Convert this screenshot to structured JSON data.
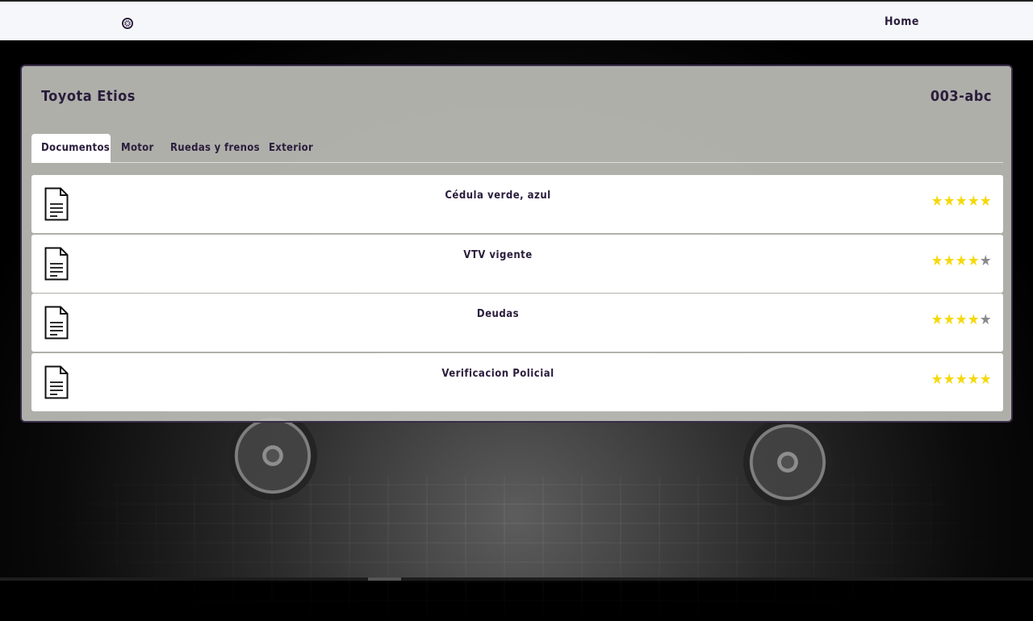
{
  "nav": {
    "logo_icon": "wheel-icon",
    "home_label": "Home"
  },
  "vehicle": {
    "title": "Toyota Etios",
    "plate": "003-abc"
  },
  "tabs": [
    {
      "label": "Documentos",
      "active": true
    },
    {
      "label": "Motor",
      "active": false
    },
    {
      "label": "Ruedas y frenos",
      "active": false
    },
    {
      "label": "Exterior",
      "active": false
    }
  ],
  "documents": [
    {
      "title": "Cédula verde, azul",
      "icon": "document-icon",
      "rating": 5,
      "max": 5
    },
    {
      "title": "VTV vigente",
      "icon": "document-icon",
      "rating": 4,
      "max": 5
    },
    {
      "title": "Deudas",
      "icon": "document-icon",
      "rating": 4,
      "max": 5
    },
    {
      "title": "Verificacion Policial",
      "icon": "document-icon",
      "rating": 5,
      "max": 5
    }
  ],
  "colors": {
    "star_on": "#f5d90a",
    "star_off": "#8a8a8a",
    "text_dark": "#2a1d3c"
  }
}
